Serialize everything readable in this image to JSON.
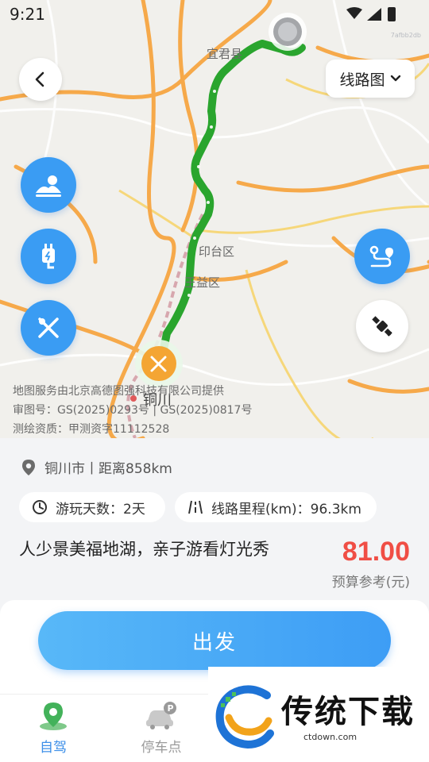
{
  "status_bar": {
    "time": "9:21",
    "watermark": "7afbb2db"
  },
  "header": {
    "back_icon": "chevron-left-icon",
    "route_map_label": "线路图",
    "route_map_icon": "chevron-down-icon"
  },
  "map": {
    "city_labels": [
      "宜君县",
      "印台区",
      "王益区",
      "铜川"
    ],
    "credits": [
      "地图服务由北京高德图强科技有限公司提供",
      "审图号：GS(2025)0293号 | GS(2025)0817号",
      "测绘资质：甲测资字11112528"
    ],
    "side_buttons_left": [
      "scenic-icon",
      "charging-icon",
      "restaurant-icon"
    ],
    "side_buttons_right": [
      "route-plan-icon",
      "satellite-icon"
    ],
    "route_color": "#2aa52e"
  },
  "info": {
    "location": "铜川市丨距离858km",
    "days_chip": "游玩天数：2天",
    "mileage_chip": "线路里程(km)：96.3km",
    "description": "人少景美福地湖，亲子游看灯光秀",
    "price": "81.00",
    "price_note": "预算参考(元)"
  },
  "action": {
    "go_label": "出发"
  },
  "nav": {
    "items": [
      {
        "label": "自驾",
        "icon": "map-pin-icon",
        "active": true
      },
      {
        "label": "停车点",
        "icon": "parking-car-icon",
        "active": false
      }
    ]
  },
  "watermark": {
    "brand": "传统下载",
    "url": "ctdown.com"
  },
  "colors": {
    "accent": "#3a9cf3",
    "price": "#f04e45",
    "active_nav": "#3d8fe8"
  }
}
